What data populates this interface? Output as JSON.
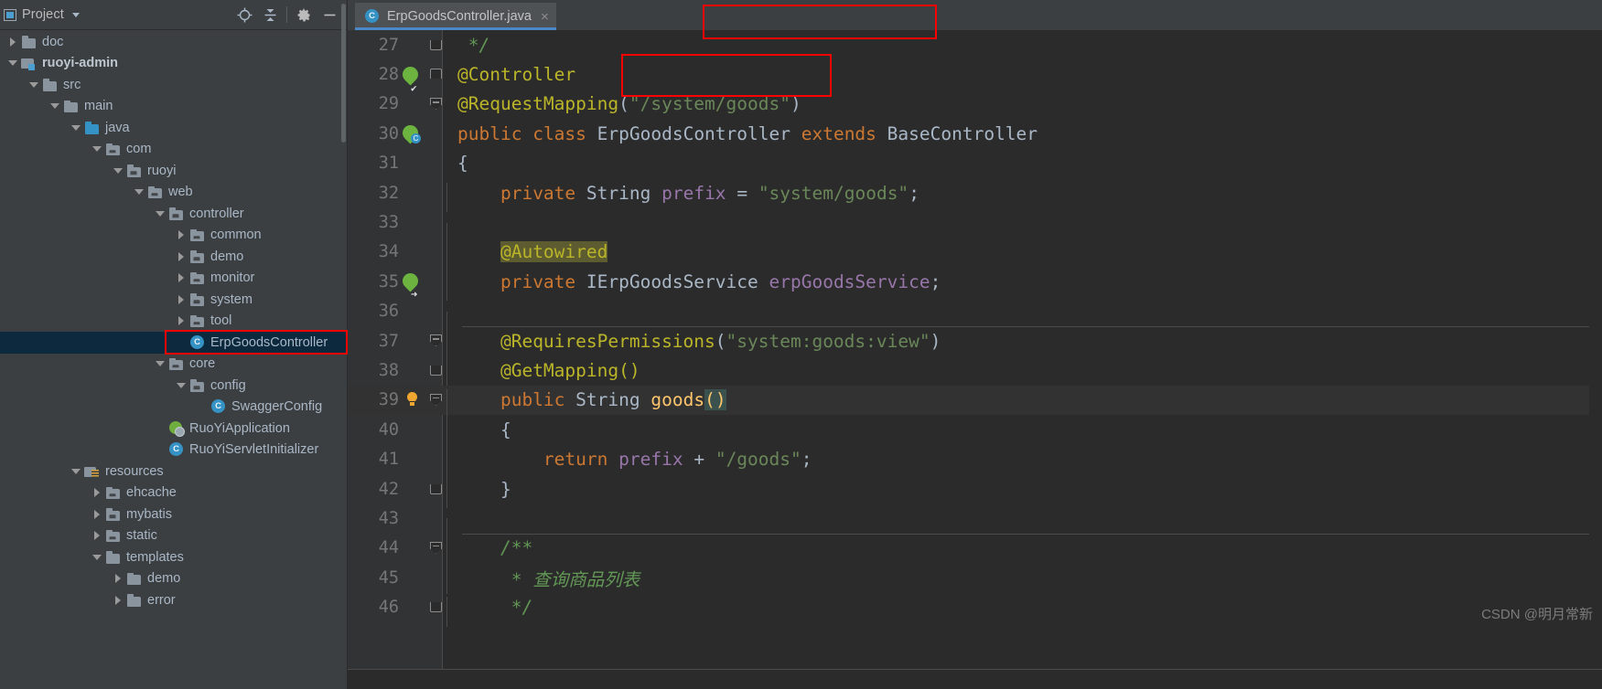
{
  "project_panel": {
    "title": "Project",
    "caret_icon": "chevron-down-icon",
    "icons": [
      {
        "name": "locate-target-icon",
        "glyph": "⊕"
      },
      {
        "name": "collapse-all-icon",
        "glyph": "≡"
      },
      {
        "name": "settings-gear-icon",
        "glyph": "⚙"
      },
      {
        "name": "hide-panel-icon",
        "glyph": "—"
      }
    ],
    "tree": [
      {
        "label": "doc",
        "depth": 0,
        "arrow": "closed",
        "icon": "folder",
        "bold": false
      },
      {
        "label": "ruoyi-admin",
        "depth": 0,
        "arrow": "open",
        "icon": "module",
        "bold": true
      },
      {
        "label": "src",
        "depth": 1,
        "arrow": "open",
        "icon": "folder",
        "bold": false
      },
      {
        "label": "main",
        "depth": 2,
        "arrow": "open",
        "icon": "folder",
        "bold": false
      },
      {
        "label": "java",
        "depth": 3,
        "arrow": "open",
        "icon": "srcroot",
        "bold": false
      },
      {
        "label": "com",
        "depth": 4,
        "arrow": "open",
        "icon": "pkg",
        "bold": false
      },
      {
        "label": "ruoyi",
        "depth": 5,
        "arrow": "open",
        "icon": "pkg",
        "bold": false
      },
      {
        "label": "web",
        "depth": 6,
        "arrow": "open",
        "icon": "pkg",
        "bold": false
      },
      {
        "label": "controller",
        "depth": 7,
        "arrow": "open",
        "icon": "pkg",
        "bold": false
      },
      {
        "label": "common",
        "depth": 8,
        "arrow": "closed",
        "icon": "pkg",
        "bold": false
      },
      {
        "label": "demo",
        "depth": 8,
        "arrow": "closed",
        "icon": "pkg",
        "bold": false
      },
      {
        "label": "monitor",
        "depth": 8,
        "arrow": "closed",
        "icon": "pkg",
        "bold": false
      },
      {
        "label": "system",
        "depth": 8,
        "arrow": "closed",
        "icon": "pkg",
        "bold": false
      },
      {
        "label": "tool",
        "depth": 8,
        "arrow": "closed",
        "icon": "pkg",
        "bold": false
      },
      {
        "label": "ErpGoodsController",
        "depth": 8,
        "arrow": "none",
        "icon": "cls",
        "bold": false,
        "selected": true
      },
      {
        "label": "core",
        "depth": 7,
        "arrow": "open",
        "icon": "pkg",
        "bold": false
      },
      {
        "label": "config",
        "depth": 8,
        "arrow": "open",
        "icon": "pkg",
        "bold": false
      },
      {
        "label": "SwaggerConfig",
        "depth": 9,
        "arrow": "none",
        "icon": "cls",
        "bold": false
      },
      {
        "label": "RuoYiApplication",
        "depth": 7,
        "arrow": "none",
        "icon": "springapp",
        "bold": false
      },
      {
        "label": "RuoYiServletInitializer",
        "depth": 7,
        "arrow": "none",
        "icon": "cls",
        "bold": false
      },
      {
        "label": "resources",
        "depth": 3,
        "arrow": "open",
        "icon": "resroot",
        "bold": false
      },
      {
        "label": "ehcache",
        "depth": 4,
        "arrow": "closed",
        "icon": "pkg",
        "bold": false
      },
      {
        "label": "mybatis",
        "depth": 4,
        "arrow": "closed",
        "icon": "pkg",
        "bold": false
      },
      {
        "label": "static",
        "depth": 4,
        "arrow": "closed",
        "icon": "pkg",
        "bold": false
      },
      {
        "label": "templates",
        "depth": 4,
        "arrow": "open",
        "icon": "folder",
        "bold": false
      },
      {
        "label": "demo",
        "depth": 5,
        "arrow": "closed",
        "icon": "folder",
        "bold": false
      },
      {
        "label": "error",
        "depth": 5,
        "arrow": "closed",
        "icon": "folder",
        "bold": false
      }
    ]
  },
  "editor": {
    "tab": {
      "filename": "ErpGoodsController.java",
      "icon": "java-class-icon",
      "close_glyph": "×",
      "active": true
    },
    "lines": [
      {
        "num": "27",
        "gutter": "",
        "fold": "bot",
        "indent": false
      },
      {
        "num": "28",
        "gutter": "spring-check",
        "fold": "top",
        "indent": false
      },
      {
        "num": "29",
        "gutter": "",
        "fold": "top-minus",
        "indent": false
      },
      {
        "num": "30",
        "gutter": "spring-class",
        "fold": "",
        "indent": false
      },
      {
        "num": "31",
        "gutter": "",
        "fold": "",
        "indent": false
      },
      {
        "num": "32",
        "gutter": "",
        "fold": "",
        "indent": true
      },
      {
        "num": "33",
        "gutter": "",
        "fold": "",
        "indent": true
      },
      {
        "num": "34",
        "gutter": "",
        "fold": "",
        "indent": true
      },
      {
        "num": "35",
        "gutter": "spring-arrow",
        "fold": "",
        "indent": true
      },
      {
        "num": "36",
        "gutter": "",
        "fold": "",
        "indent": true
      },
      {
        "num": "37",
        "gutter": "",
        "fold": "top-minus",
        "indent": true,
        "sep_above": true
      },
      {
        "num": "38",
        "gutter": "",
        "fold": "bot-open",
        "indent": true
      },
      {
        "num": "39",
        "gutter": "bulb",
        "fold": "top-minus",
        "indent": true,
        "caret": true
      },
      {
        "num": "40",
        "gutter": "",
        "fold": "",
        "indent": true
      },
      {
        "num": "41",
        "gutter": "",
        "fold": "",
        "indent": true
      },
      {
        "num": "42",
        "gutter": "",
        "fold": "bot-open",
        "indent": true
      },
      {
        "num": "43",
        "gutter": "",
        "fold": "",
        "indent": true
      },
      {
        "num": "44",
        "gutter": "",
        "fold": "top-minus",
        "indent": true,
        "sep_above": true
      },
      {
        "num": "45",
        "gutter": "",
        "fold": "",
        "indent": true
      },
      {
        "num": "46",
        "gutter": "",
        "fold": "bot-open",
        "indent": true
      }
    ],
    "code_text": {
      "l27": "*/",
      "l28": "@Controller",
      "l29": "@RequestMapping(\"/system/goods\")",
      "l30": "public class ErpGoodsController extends BaseController",
      "l31": "{",
      "l32": "    private String prefix = \"system/goods\";",
      "l33": "",
      "l34": "    @Autowired",
      "l35": "    private IErpGoodsService erpGoodsService;",
      "l36": "",
      "l37": "    @RequiresPermissions(\"system:goods:view\")",
      "l38": "    @GetMapping()",
      "l39": "    public String goods()",
      "l40": "    {",
      "l41": "        return prefix + \"/goods\";",
      "l42": "    }",
      "l43": "",
      "l44": "    /**",
      "l45": "     * 查询商品列表",
      "l46": "     */"
    },
    "tokens": {
      "comment_close": "*/",
      "anno_controller": "@Controller",
      "anno_requestmapping": "@RequestMapping",
      "paren_open": "(",
      "paren_close": ")",
      "str_system_goods_path": "\"/system/goods\"",
      "kw_public": "public",
      "kw_class": "class",
      "cls_erpgoodscontroller": "ErpGoodsController",
      "kw_extends": "extends",
      "cls_basecontroller": "BaseController",
      "brace_open": "{",
      "brace_close": "}",
      "kw_private": "private",
      "type_string": "String",
      "field_prefix": "prefix",
      "op_eq": "=",
      "str_system_goods": "\"system/goods\"",
      "semi": ";",
      "anno_autowired": "@Autowired",
      "type_ierpgoodsservice": "IErpGoodsService",
      "field_erpgoodsservice": "erpGoodsService",
      "anno_requirespermissions": "@RequiresPermissions",
      "str_permission": "\"system:goods:view\"",
      "anno_getmapping": "@GetMapping",
      "empty_parens": "()",
      "meth_goods": "goods",
      "kw_return": "return",
      "op_plus": "+",
      "str_goods_path": "\"/goods\"",
      "doc_open": "/**",
      "doc_star": "*",
      "doc_text_cn": "查询商品列表",
      "doc_close": "*/"
    }
  },
  "annotations": {
    "tab_box": {
      "name": "tab-highlight-box",
      "color": "#ff0000"
    },
    "mapping_box": {
      "name": "request-mapping-highlight-box",
      "color": "#ff0000"
    },
    "tree_box": {
      "name": "tree-selection-highlight-box",
      "color": "#ff0000"
    }
  },
  "watermark": {
    "text": "CSDN @明月常新"
  },
  "colors": {
    "panel_bg": "#3c3f41",
    "editor_bg": "#2b2b2b",
    "gutter_bg": "#313335",
    "selection_bg": "#0d293e",
    "accent_blue": "#4a88c7",
    "annotation_red": "#ff0000",
    "annotation_yellow": "#bbb529",
    "string_green": "#6a8759",
    "keyword_orange": "#cc7832",
    "field_purple": "#9876aa",
    "comment_green": "#629755"
  }
}
